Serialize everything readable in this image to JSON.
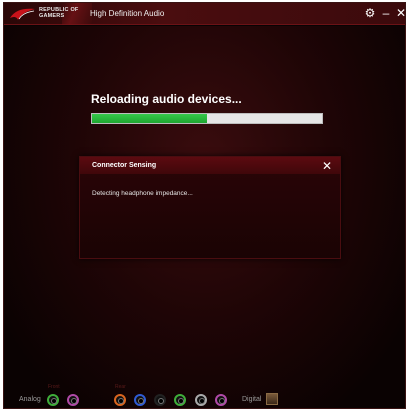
{
  "window": {
    "brand_line1": "REPUBLIC OF",
    "brand_line2": "GAMERS",
    "title": "High Definition Audio"
  },
  "titlebar_icons": [
    "gear-icon",
    "minimize-icon",
    "close-icon"
  ],
  "titlebar_glyphs": {
    "settings": "⚙",
    "minimize": "–",
    "close": "✕"
  },
  "status": {
    "text": "Reloading audio devices...",
    "progress_fraction": 0.5,
    "progress_color": "#2bb83e"
  },
  "dialog": {
    "title": "Connector Sensing",
    "close_glyph": "✕",
    "message": "Detecting headphone impedance..."
  },
  "bottom": {
    "front_label": "Front",
    "rear_label": "Rear",
    "analog_label": "Analog",
    "digital_label": "Digital",
    "front_jacks": [
      "#3fae3a",
      "#b04aa8"
    ],
    "rear_jacks": [
      "#d9651f",
      "#2f5bd4",
      "#222222",
      "#3fae3a",
      "#aaaaaa",
      "#b04aa8"
    ]
  },
  "colors": {
    "accent_red": "#5c0a10",
    "background": "#080303"
  }
}
